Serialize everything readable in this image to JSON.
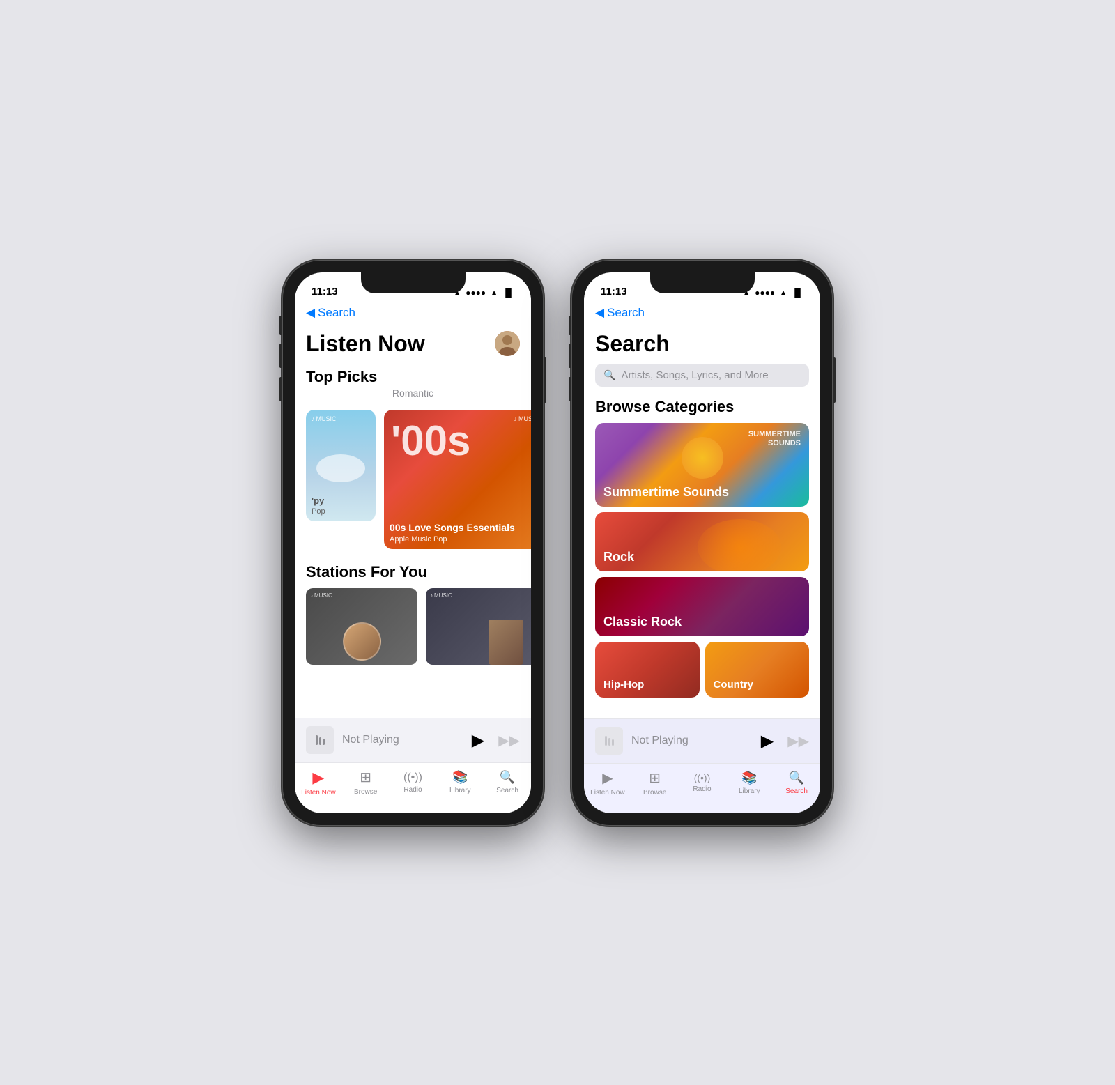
{
  "phone1": {
    "statusBar": {
      "time": "11:13",
      "locationIcon": "▲",
      "wifiIcon": "wifi",
      "batteryIcon": "battery"
    },
    "backNav": "◀ Search",
    "listenNow": {
      "title": "Listen Now",
      "avatar": "👤",
      "topPicks": {
        "sectionTitle": "Top Picks",
        "subtitle": "Romantic",
        "card1": {
          "badge": "♪ MUSIC",
          "label": "'py",
          "sublabel": "Pop"
        },
        "card2": {
          "badge": "♪ MUSIC",
          "bigText": "'00s",
          "title": "00s Love Songs Essentials",
          "subtitle": "Apple Music Pop"
        }
      },
      "stationsForYou": {
        "sectionTitle": "Stations For You",
        "badge1": "♪ MUSIC",
        "badge2": "♪ MUSIC"
      }
    },
    "nowPlaying": {
      "label": "Not Playing"
    },
    "tabBar": {
      "items": [
        {
          "icon": "▶",
          "label": "Listen Now",
          "active": true
        },
        {
          "icon": "⊞",
          "label": "Browse",
          "active": false
        },
        {
          "icon": "((•))",
          "label": "Radio",
          "active": false
        },
        {
          "icon": "📚",
          "label": "Library",
          "active": false
        },
        {
          "icon": "🔍",
          "label": "Search",
          "active": false
        }
      ]
    }
  },
  "phone2": {
    "statusBar": {
      "time": "11:13",
      "locationIcon": "▲"
    },
    "backNav": "◀ Search",
    "search": {
      "title": "Search",
      "placeholder": "Artists, Songs, Lyrics, and More",
      "browseTitle": "Browse Categories",
      "categories": [
        {
          "name": "Summertime Sounds",
          "style": "wide",
          "topLabel": "SUMMERTIME\nSOUNDS",
          "color": "summertime"
        },
        {
          "name": "Rock",
          "style": "normal",
          "color": "rock"
        },
        {
          "name": "Classic Rock",
          "style": "normal",
          "color": "classic-rock"
        },
        {
          "name": "Hip-Hop",
          "style": "half",
          "color": "hiphop"
        },
        {
          "name": "Country",
          "style": "half",
          "color": "country"
        }
      ]
    },
    "nowPlaying": {
      "label": "Not Playing"
    },
    "tabBar": {
      "items": [
        {
          "icon": "▶",
          "label": "Listen Now",
          "active": false
        },
        {
          "icon": "⊞",
          "label": "Browse",
          "active": false
        },
        {
          "icon": "((•))",
          "label": "Radio",
          "active": false
        },
        {
          "icon": "📚",
          "label": "Library",
          "active": false
        },
        {
          "icon": "🔍",
          "label": "Search",
          "active": true
        }
      ]
    }
  }
}
